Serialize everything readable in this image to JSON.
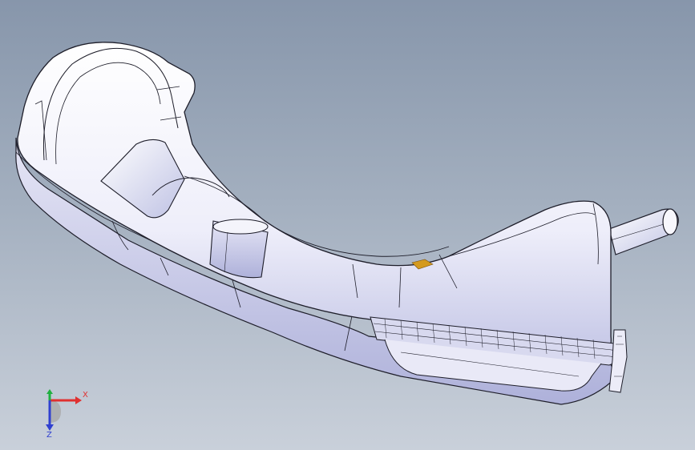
{
  "viewport": {
    "background_top": "#8796ab",
    "background_bottom": "#c9d0da"
  },
  "model": {
    "body_color": "#f4f4fb",
    "shadow_color": "#b9bce0",
    "edge_color": "#1e1e2a",
    "accent_color": "#d49a1e"
  },
  "triad": {
    "x_label": "X",
    "z_label": "Z",
    "x_color": "#e03030",
    "y_color": "#20b040",
    "z_color": "#3040d0"
  }
}
